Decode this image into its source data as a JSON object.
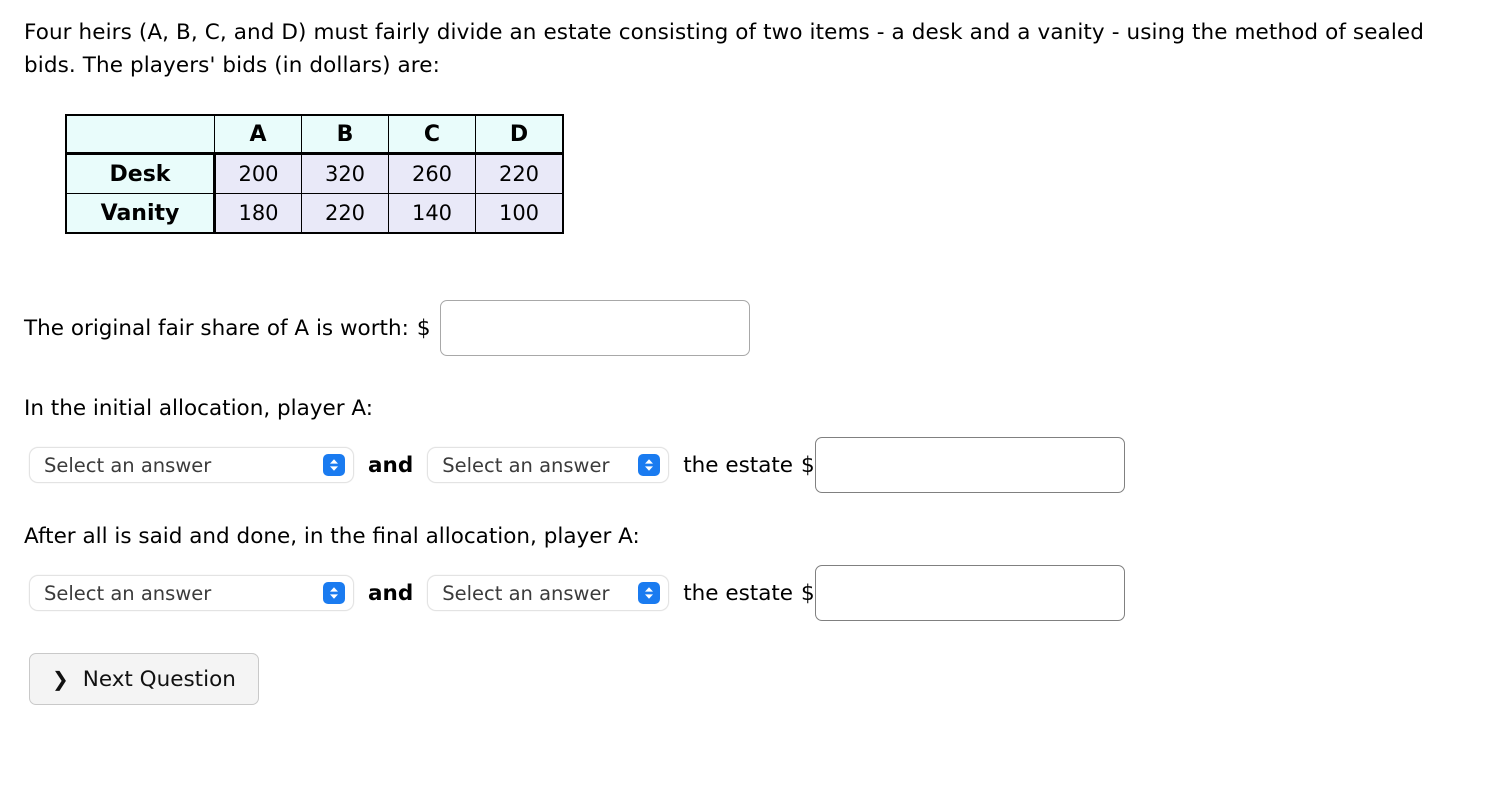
{
  "prompt": {
    "text": "Four heirs (A, B, C, and D) must fairly divide an estate consisting of two items - a desk and a vanity - using the method of sealed bids. The players' bids (in dollars) are:"
  },
  "bids_table": {
    "corner_label": "",
    "players": [
      "A",
      "B",
      "C",
      "D"
    ],
    "rows": [
      {
        "item": "Desk",
        "bids": [
          "200",
          "320",
          "260",
          "220"
        ]
      },
      {
        "item": "Vanity",
        "bids": [
          "180",
          "220",
          "140",
          "100"
        ]
      }
    ],
    "header_bg": "#e9fcfb",
    "cell_bg": "#e9e9f8",
    "border_color": "#000000"
  },
  "questions": {
    "fair_share": {
      "label": "The original fair share of A is worth:",
      "currency": "$",
      "input_value": "",
      "input_placeholder": ""
    },
    "initial_allocation": {
      "label": "In the initial allocation, player A:",
      "select_action": "Select an answer",
      "conjunction": "and",
      "select_direction": "Select an answer",
      "phrase": "the estate",
      "currency": "$",
      "input_value": "",
      "input_placeholder": ""
    },
    "final_allocation": {
      "label": "After all is said and done, in the final allocation, player A:",
      "select_action": "Select an answer",
      "conjunction": "and",
      "select_direction": "Select an answer",
      "phrase": "the estate",
      "currency": "$",
      "input_value": "",
      "input_placeholder": ""
    }
  },
  "footer": {
    "next_button_label": "Next Question",
    "next_button_chevron": "❯"
  },
  "colors": {
    "stepper_blue": "#1a7bf0",
    "input_border": "#9a9a9a",
    "button_bg": "#f4f4f4"
  }
}
